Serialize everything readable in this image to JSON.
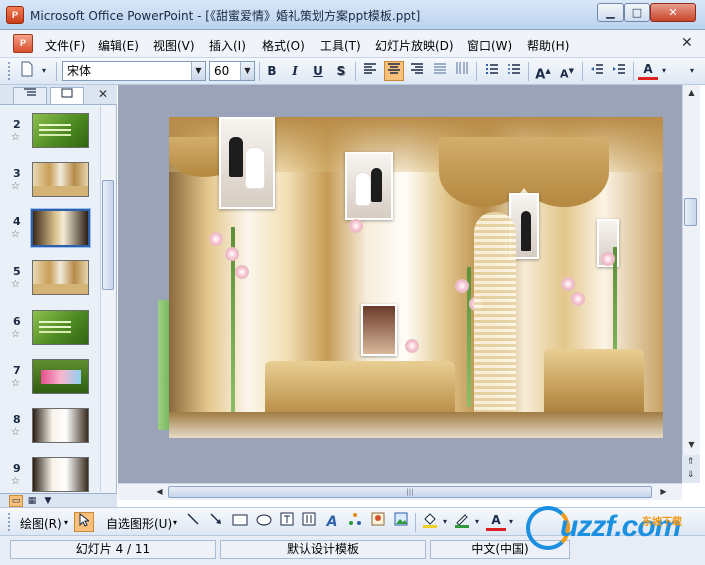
{
  "window": {
    "app_icon": "P",
    "title": "Microsoft Office PowerPoint - [《甜蜜爱情》婚礼策划方案ppt模板.ppt]",
    "min": "▁",
    "max": "□",
    "close": "✕"
  },
  "menu": {
    "doc_icon": "P",
    "items": [
      "文件(F)",
      "编辑(E)",
      "视图(V)",
      "插入(I)",
      "格式(O)",
      "工具(T)",
      "幻灯片放映(D)",
      "窗口(W)",
      "帮助(H)"
    ],
    "close": "✕"
  },
  "format_toolbar": {
    "font_name": "宋体",
    "font_size": "60",
    "bold": "B",
    "italic": "I",
    "underline": "U",
    "shadow": "S",
    "font_color": "A"
  },
  "left_pane": {
    "tabs": [
      "outline-tab",
      "slides-tab"
    ],
    "close": "✕",
    "slides": [
      {
        "num": "2"
      },
      {
        "num": "3"
      },
      {
        "num": "4"
      },
      {
        "num": "5"
      },
      {
        "num": "6"
      },
      {
        "num": "7"
      },
      {
        "num": "8"
      },
      {
        "num": "9"
      }
    ],
    "selected_slide": "4"
  },
  "draw_toolbar": {
    "draw_label": "绘图(R)",
    "autoshape_label": "自选图形(U)",
    "font_color": "A"
  },
  "status": {
    "slide_info": "幻灯片 4 / 11",
    "template": "默认设计模板",
    "language": "中文(中国)"
  },
  "watermark": {
    "brand": "uzzf.com",
    "sub": "东坡下载"
  },
  "colors": {
    "accent": "#f8c07a",
    "chrome": "#dde7f4",
    "slide_bg": "#9aa3b8"
  }
}
